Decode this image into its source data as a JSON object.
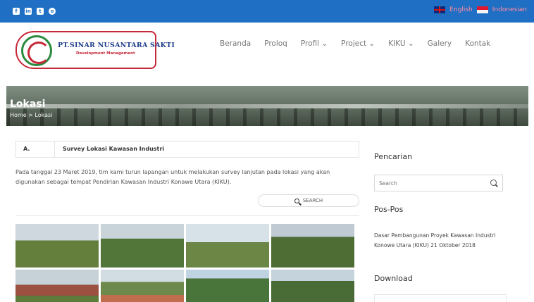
{
  "topbar": {
    "social_icons": [
      "facebook-icon",
      "linkedin-icon",
      "twitter-icon",
      "instagram-icon"
    ],
    "languages": [
      {
        "label": "English",
        "flag": "uk-flag-icon"
      },
      {
        "label": "Indonesian",
        "flag": "indonesia-flag-icon"
      }
    ]
  },
  "logo": {
    "title": "PT.SINAR NUSANTARA SAKTI",
    "subtitle": "Development Management"
  },
  "nav": {
    "items": [
      {
        "label": "Beranda"
      },
      {
        "label": "Proloq"
      },
      {
        "label": "Profil ⌄"
      },
      {
        "label": "Project ⌄"
      },
      {
        "label": "KIKU ⌄"
      },
      {
        "label": "Galery"
      },
      {
        "label": "Kontak"
      }
    ]
  },
  "banner": {
    "title": "Lokasi",
    "breadcrumb": "Home  >  Lokasi"
  },
  "content": {
    "section_letter": "A.",
    "section_title": "Survey Lokasi Kawasan Industri",
    "paragraph": "Pada tanggal 23 Maret 2019, tim kami turun lapangan untuk melakukan survey lanjutan pada lokasi yang akan digunakan sebagai tempat Pendirian Kawasan Industri Konawe Utara (KIKU).",
    "search_button": "SEARCH"
  },
  "sidebar": {
    "search_heading": "Pencarian",
    "search_placeholder": "Search",
    "posts_heading": "Pos-Pos",
    "post_item": "Dasar Pembangunan Proyek Kawasan Industri Konowe Utara (KIKU) 21 Oktober 2018",
    "download_heading": "Download"
  },
  "colors": {
    "topbar": "#1f6fc4",
    "accent_red": "#c6283a",
    "accent_green": "#2a8a3e"
  }
}
